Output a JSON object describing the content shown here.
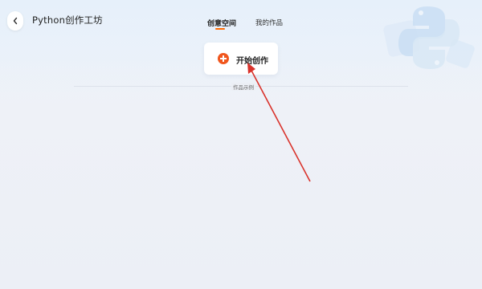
{
  "header": {
    "app_title": "Python创作工坊",
    "back_icon": "chevron-left-icon"
  },
  "tabs": [
    {
      "label": "创意空间",
      "active": true
    },
    {
      "label": "我的作品",
      "active": false
    }
  ],
  "start_card": {
    "label": "开始创作",
    "icon": "plus-circle-icon"
  },
  "section": {
    "label": "作品示例"
  },
  "colors": {
    "accent": "#ff6a00",
    "plus_icon": "#f0561d",
    "annotation_arrow": "#d9322b"
  }
}
